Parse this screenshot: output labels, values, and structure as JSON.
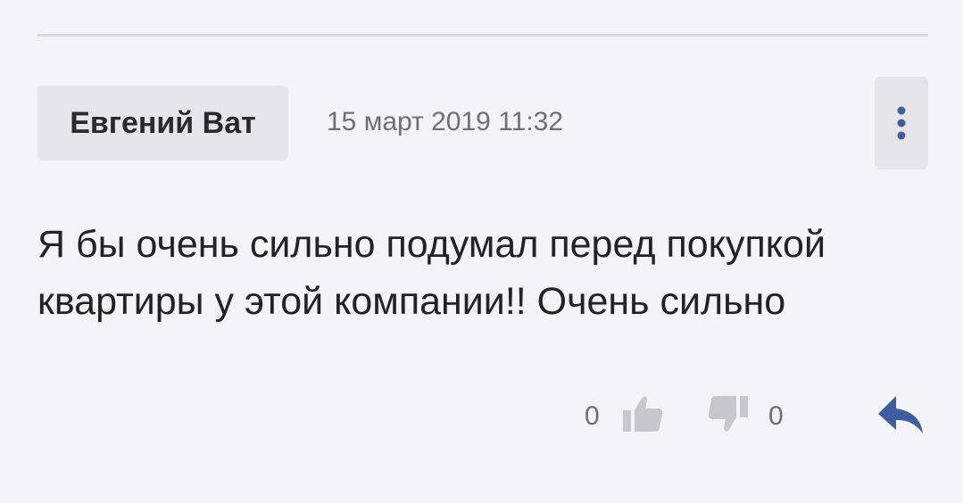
{
  "comment": {
    "author": "Евгений Ват",
    "timestamp": "15 март 2019 11:32",
    "text": "Я бы очень сильно подумал перед покупкой квартиры у этой компании!! Очень сильно"
  },
  "votes": {
    "likes": "0",
    "dislikes": "0"
  },
  "icons": {
    "menu": "more-vertical-icon",
    "like": "thumbs-up-icon",
    "dislike": "thumbs-down-icon",
    "reply": "reply-icon"
  },
  "colors": {
    "background": "#f4f4f6",
    "chip": "#e6e6e9",
    "accent": "#3d5fa0",
    "vote_icon": "#c8c8cc"
  }
}
